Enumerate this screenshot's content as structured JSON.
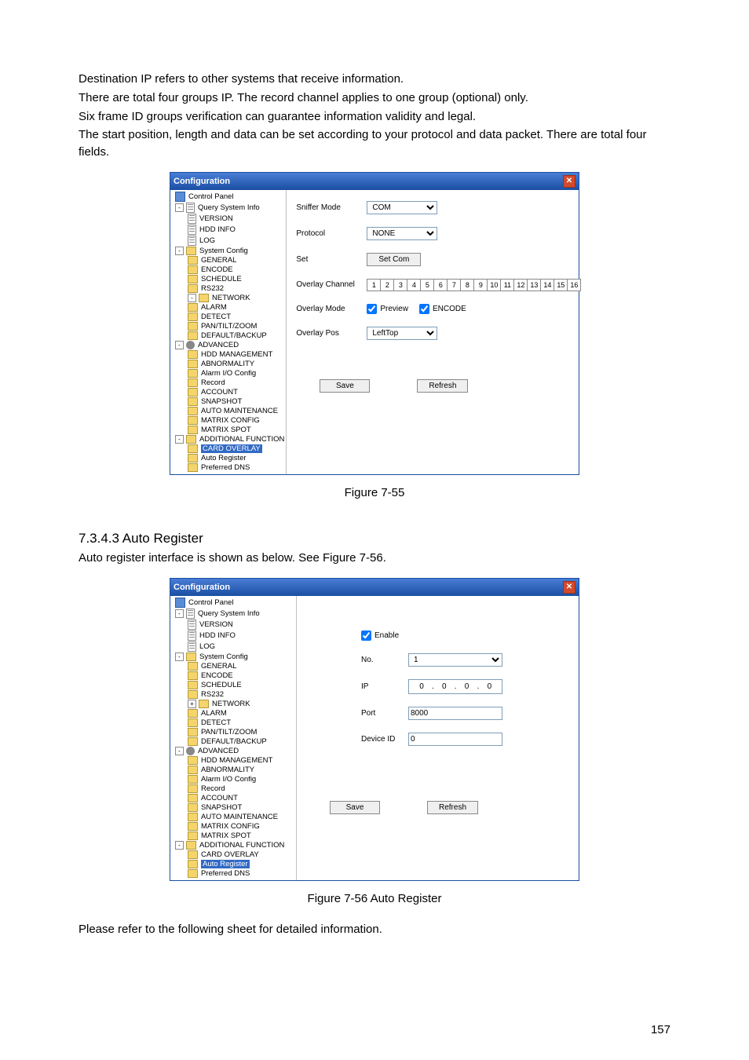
{
  "intro": {
    "p1": "Destination IP refers to other systems that receive information.",
    "p2": "There are total four groups IP. The record channel applies to one group (optional) only.",
    "p3": "Six frame ID groups verification can guarantee information validity and legal.",
    "p4": "The start position, length and data can be set according to your protocol and data packet. There are total four fields."
  },
  "window_title": "Configuration",
  "tree": {
    "control_panel": "Control Panel",
    "query_system_info": "Query System Info",
    "version": "VERSION",
    "hdd_info": "HDD INFO",
    "log": "LOG",
    "system_config": "System Config",
    "general": "GENERAL",
    "encode": "ENCODE",
    "schedule": "SCHEDULE",
    "rs232": "RS232",
    "network": "NETWORK",
    "alarm": "ALARM",
    "detect": "DETECT",
    "ptz": "PAN/TILT/ZOOM",
    "default_backup": "DEFAULT/BACKUP",
    "advanced": "ADVANCED",
    "hdd_management": "HDD MANAGEMENT",
    "abnormality": "ABNORMALITY",
    "alarm_io": "Alarm I/O Config",
    "record": "Record",
    "account": "ACCOUNT",
    "snapshot": "SNAPSHOT",
    "auto_maintenance": "AUTO MAINTENANCE",
    "matrix_config": "MATRIX CONFIG",
    "matrix_spot": "MATRIX SPOT",
    "additional_function": "ADDITIONAL FUNCTION",
    "card_overlay": "CARD OVERLAY",
    "auto_register": "Auto Register",
    "preferred_dns": "Preferred DNS"
  },
  "card_overlay_panel": {
    "sniffer_mode_lbl": "Sniffer Mode",
    "sniffer_mode_val": "COM",
    "protocol_lbl": "Protocol",
    "protocol_val": "NONE",
    "set_lbl": "Set",
    "set_btn": "Set Com",
    "overlay_channel_lbl": "Overlay Channel",
    "channels": [
      "1",
      "2",
      "3",
      "4",
      "5",
      "6",
      "7",
      "8",
      "9",
      "10",
      "11",
      "12",
      "13",
      "14",
      "15",
      "16"
    ],
    "overlay_mode_lbl": "Overlay Mode",
    "overlay_mode_preview": "Preview",
    "overlay_mode_encode": "ENCODE",
    "overlay_pos_lbl": "Overlay Pos",
    "overlay_pos_val": "LeftTop",
    "save_btn": "Save",
    "refresh_btn": "Refresh"
  },
  "caption1": "Figure 7-55",
  "section": {
    "num_title": "7.3.4.3  Auto Register",
    "line": "Auto register interface is shown as below. See Figure 7-56."
  },
  "auto_register_panel": {
    "enable_lbl": "Enable",
    "no_lbl": "No.",
    "no_val": "1",
    "ip_lbl": "IP",
    "ip": [
      "0",
      "0",
      "0",
      "0"
    ],
    "port_lbl": "Port",
    "port_val": "8000",
    "device_id_lbl": "Device ID",
    "device_id_val": "0",
    "save_btn": "Save",
    "refresh_btn": "Refresh"
  },
  "caption2": "Figure 7-56 Auto Register",
  "footer_line": "Please refer to the following sheet for detailed information.",
  "page_number": "157"
}
